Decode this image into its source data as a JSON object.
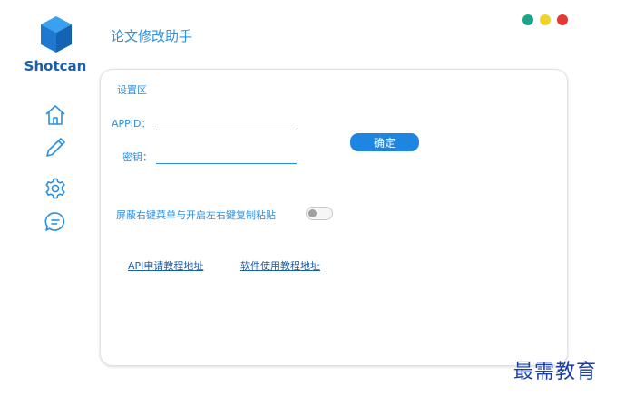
{
  "app": {
    "logo_text": "Shotcan",
    "title": "论文修改助手"
  },
  "sidebar": {
    "items": [
      {
        "icon": "home-icon"
      },
      {
        "icon": "pen-icon"
      },
      {
        "icon": "gear-icon"
      },
      {
        "icon": "chat-icon"
      }
    ]
  },
  "window_controls": {
    "colors": [
      "#1aa58b",
      "#f0d22a",
      "#e53935"
    ]
  },
  "settings": {
    "section_title": "设置区",
    "appid_label": "APPID：",
    "appid_value": "",
    "secret_label": "密钥：",
    "secret_value": "",
    "confirm_label": "确定",
    "toggle_label": "屏蔽右键菜单与开启左右键复制粘贴",
    "toggle_on": false,
    "links": {
      "api_tutorial": "API申请教程地址",
      "software_tutorial": "软件使用教程地址"
    }
  },
  "watermark": "最需教育",
  "colors": {
    "accent": "#2a8fe0",
    "button": "#1e86e0",
    "link": "#1b5fa8"
  }
}
